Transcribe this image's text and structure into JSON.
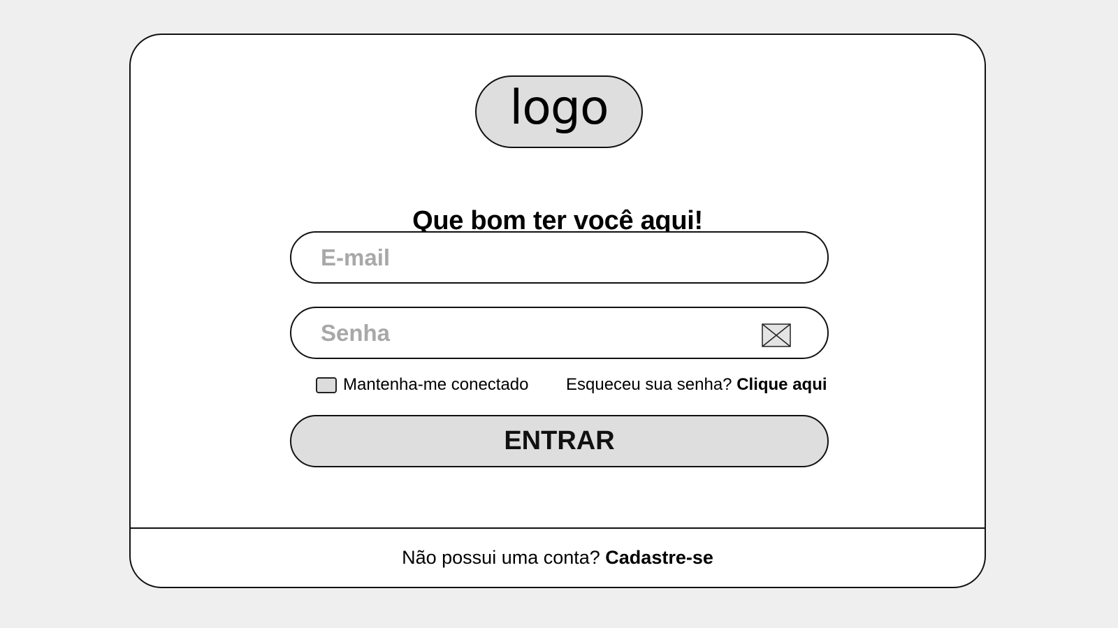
{
  "logo": {
    "text": "logo"
  },
  "welcome": {
    "title": "Que bom ter você aqui!"
  },
  "form": {
    "email_placeholder": "E-mail",
    "email_value": "",
    "password_placeholder": "Senha",
    "password_value": "",
    "password_toggle_icon": "image-placeholder-icon",
    "remember_label": "Mantenha-me conectado",
    "remember_checked": false,
    "forgot_text": "Esqueceu sua senha?",
    "forgot_link": "Clique aqui",
    "submit_label": "ENTRAR"
  },
  "footer": {
    "text": "Não possui uma conta?",
    "signup_link": "Cadastre-se"
  },
  "colors": {
    "background": "#efefef",
    "card": "#ffffff",
    "fill_gray": "#dedede",
    "border": "#111111",
    "placeholder": "#a8a8a8"
  }
}
